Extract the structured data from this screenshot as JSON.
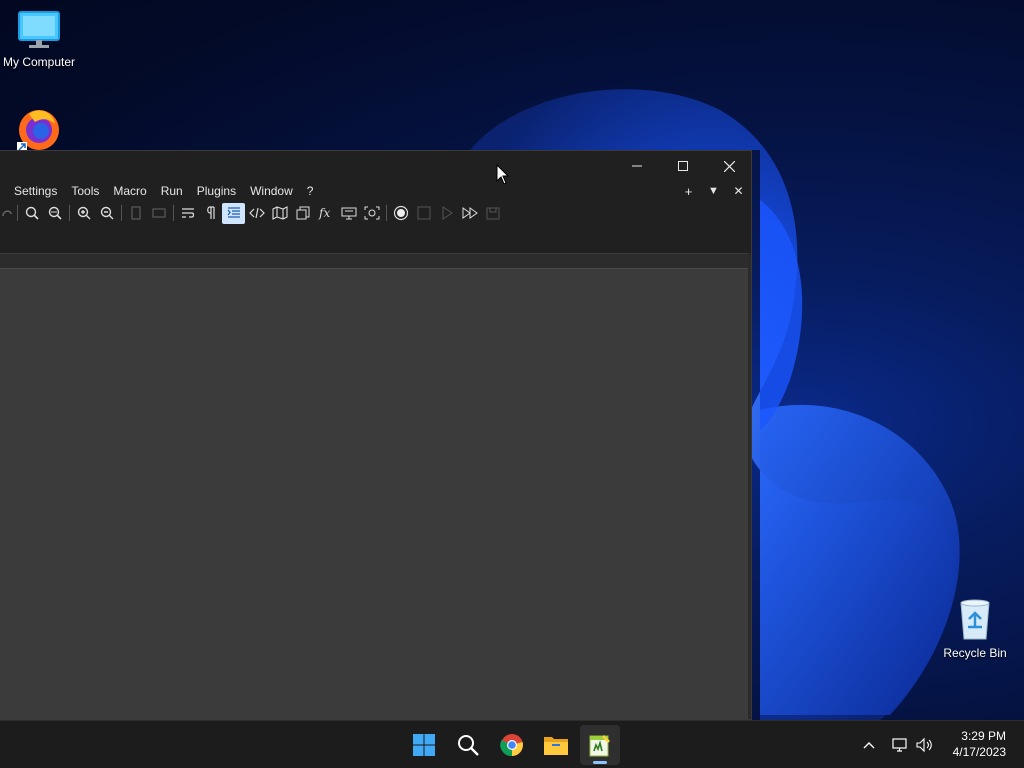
{
  "desktop": {
    "icons": [
      {
        "label": "My Computer",
        "icon": "monitor-icon"
      },
      {
        "label": "",
        "icon": "firefox-icon"
      },
      {
        "label": "Recycle Bin",
        "icon": "recycle-bin-icon"
      }
    ]
  },
  "window": {
    "app": "Notepad++",
    "controls": {
      "minimize": "minimize-icon",
      "maximize": "maximize-icon",
      "close": "close-icon"
    },
    "menu": [
      "Settings",
      "Tools",
      "Macro",
      "Run",
      "Plugins",
      "Window",
      "?"
    ],
    "menu_right": {
      "add": "+",
      "dropdown": "▼",
      "close": "✕"
    },
    "toolbar_active": "wrap-indent-guide-icon"
  },
  "taskbar": {
    "apps": [
      "start-icon",
      "search-icon",
      "chrome-icon",
      "file-explorer-icon",
      "notepadpp-icon"
    ],
    "active_app": "notepadpp-icon",
    "clock": {
      "time": "3:29 PM",
      "date": "4/17/2023"
    }
  },
  "colors": {
    "accent": "#0078d4",
    "window_bg": "#202020",
    "editor_bg": "#3b3b3b",
    "taskbar_bg": "#1c1c1c"
  }
}
